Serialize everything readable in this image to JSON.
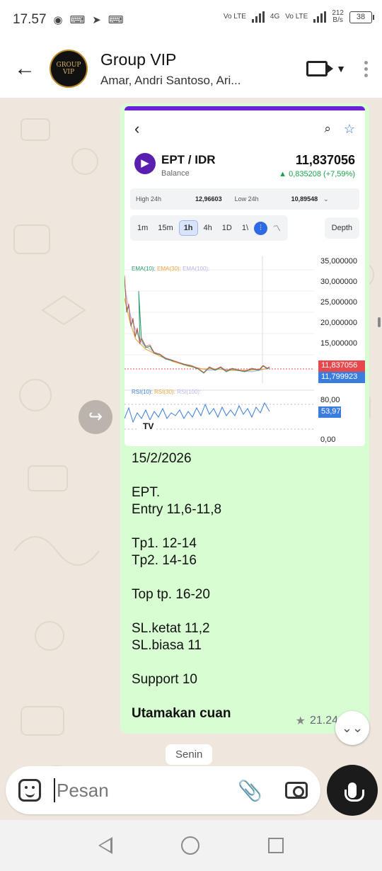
{
  "status_bar": {
    "time": "17.57",
    "icons": [
      "go-icon",
      "gamepad-icon",
      "telegram-icon",
      "gamepad-icon"
    ],
    "net1": "Vo LTE",
    "net2": "4G",
    "net3": "Vo LTE",
    "speed": "212",
    "speed_unit": "B/s",
    "battery": "38"
  },
  "header": {
    "title": "Group VIP",
    "members": "Amar, Andri Santoso, Ari...",
    "avatar_text": "GROUP VIP"
  },
  "screenshot": {
    "pair": "EPT / IDR",
    "pair_sub": "Balance",
    "price": "11,837056",
    "change": "▲ 0,835208 (+7,59%)",
    "high_label": "High 24h",
    "high_value": "12,96603",
    "low_label": "Low 24h",
    "low_value": "10,89548",
    "timeframes": [
      "1m",
      "15m",
      "1h",
      "4h",
      "1D",
      "1\\"
    ],
    "active_timeframe": "1h",
    "depth": "Depth",
    "ema_legend": [
      "EMA(10):",
      "EMA(30):",
      "EMA(100):"
    ],
    "rsi_legend": [
      "RSI(10):",
      "RSI(30):",
      "RSI(100):"
    ],
    "price_axis": [
      "35,000000",
      "30,000000",
      "25,000000",
      "20,000000",
      "15,000000"
    ],
    "price_tag_red": "11,837056",
    "price_tag_blue": "11,799923",
    "rsi_axis": [
      "80,00",
      "0,00"
    ],
    "rsi_tag": "53,97",
    "colors": {
      "accent": "#6b21d6",
      "up": "#19a34a",
      "down": "#e5484d",
      "blue": "#3b7ddd"
    }
  },
  "message": {
    "date": "15/2/2026",
    "block1": "EPT.\nEntry 11,6-11,8",
    "block2": "Tp1. 12-14\nTp2. 14-16",
    "block3": "Top tp. 16-20",
    "block4": "SL.ketat 11,2\nSL.biasa 11",
    "block5": "Support 10",
    "bold_line": "Utamakan cuan",
    "time": "21.24"
  },
  "day_chip": "Senin",
  "composer": {
    "placeholder": "Pesan"
  }
}
